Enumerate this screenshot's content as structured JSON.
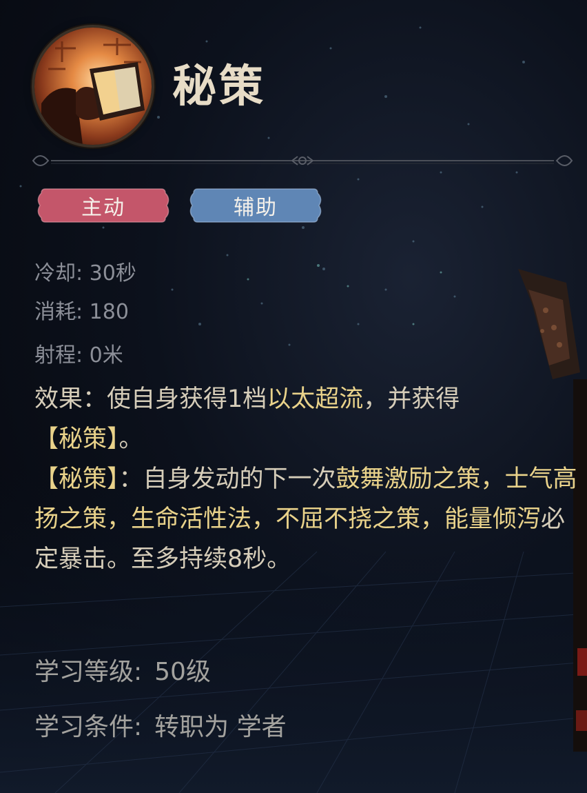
{
  "skill": {
    "name": "秘策",
    "icon": "scroll-reading-icon"
  },
  "tags": {
    "active": "主动",
    "support": "辅助"
  },
  "stats": {
    "cooldown": "冷却: 30秒",
    "cost": "消耗: 180",
    "range": "射程: 0米"
  },
  "description": {
    "effect_prefix": "效果：使自身获得1档",
    "effect_highlight": "以太超流",
    "effect_suffix": "，并获得",
    "bracket_term": "【秘策】",
    "end_mark": "。",
    "detail_term": "【秘策】",
    "detail_colon": "：",
    "detail_prefix": "自身发动的下一次",
    "detail_skills": "鼓舞激励之策，士气高扬之策，生命活性法，不屈不挠之策，能量倾泻",
    "detail_suffix": "必定暴击。至多持续8秒。"
  },
  "learn": {
    "level_label": "学习等级:",
    "level_value": "50级",
    "cond_label": "学习条件:",
    "cond_value": "转职为 学者"
  },
  "colors": {
    "active_tag": "#c4566a",
    "support_tag": "#5f86b5",
    "highlight": "#e9d28a"
  }
}
